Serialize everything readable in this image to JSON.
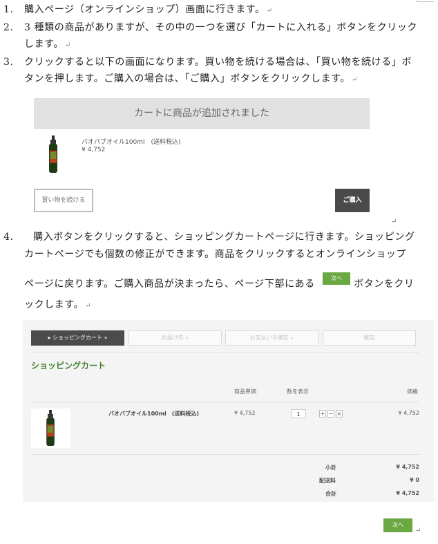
{
  "steps": [
    {
      "num": "1.",
      "text": "購入ページ（オンラインショップ）画面に行きます。"
    },
    {
      "num": "2.",
      "text1": "3 種類の商品がありますが、その中の一つを選び「カートに入れる」ボタンをクリック",
      "text2": "します。"
    },
    {
      "num": "3.",
      "text1": "クリックすると以下の画面になります。買い物を続ける場合は、「買い物を続ける」ボ",
      "text2": "タンを押します。ご購入の場合は、「ご購入」ボタンをクリックします。"
    },
    {
      "num": "4.",
      "text1": "購入ボタンをクリックすると、ショッピングカートページに行きます。ショッピング",
      "text2": "カートページでも個数の修正ができます。商品をクリックするとオンラインショップ",
      "text3a": "ページに戻ります。ご購入商品が決まったら、ページ下部にある",
      "text3b": "ボタンをクリ",
      "text4": "ックします。"
    }
  ],
  "para_mark": "↵",
  "modal": {
    "header": "カートに商品が追加されました",
    "product_name": "バオバブオイル100ml　(送料税込)",
    "product_price": "¥ 4,752",
    "continue_label": "買い物を続ける",
    "buy_label": "ご購入"
  },
  "next_label": "次へ",
  "cart": {
    "steps": [
      {
        "label": "▸ ショッピングカート »",
        "active": true
      },
      {
        "label": "お届け先 »",
        "active": false
      },
      {
        "label": "お支払いを確定 »",
        "active": false
      },
      {
        "label": "確定",
        "active": false
      }
    ],
    "title": "ショッピングカート",
    "columns": {
      "unit_price": "商品単価",
      "qty": "数を表示",
      "price": "価格"
    },
    "item": {
      "name": "バオバブオイル100ml　(送料税込)",
      "unit_price": "¥ 4,752",
      "qty": "1",
      "price": "¥ 4,752"
    },
    "qty_buttons": [
      "+",
      "−",
      "×"
    ],
    "summary": [
      {
        "label": "小計",
        "value": "¥ 4,752"
      },
      {
        "label": "配送料",
        "value": "¥ 0"
      },
      {
        "label": "合計",
        "value": "¥ 4,752"
      }
    ]
  },
  "colors": {
    "green": "#6aa842",
    "title_green": "#3f7d2c",
    "dark": "#4b4b4b"
  }
}
